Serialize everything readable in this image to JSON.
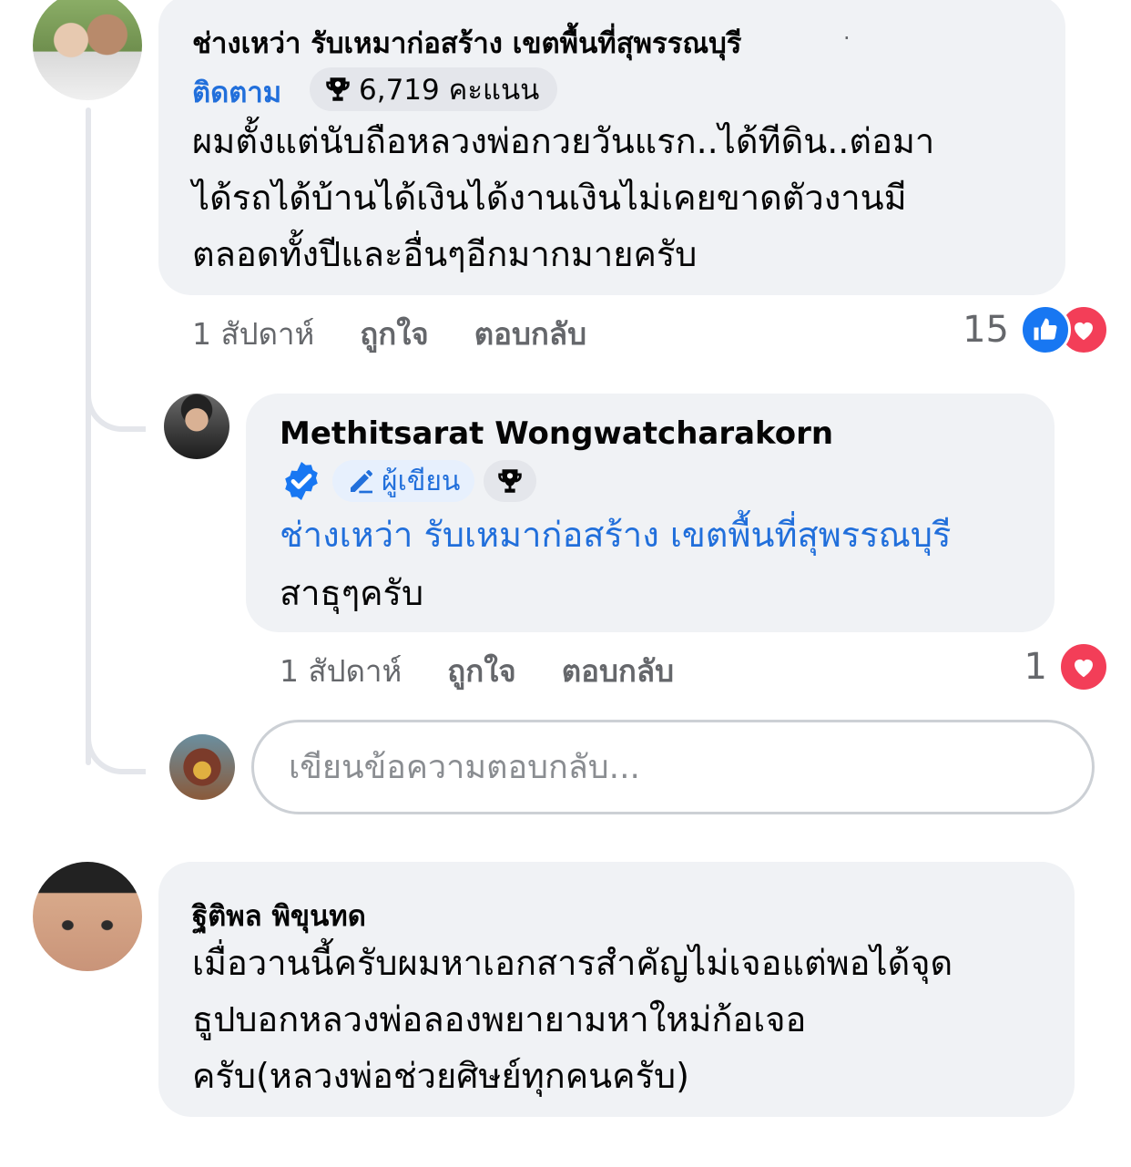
{
  "comment1": {
    "author": "ช่างเหว่า รับเหมาก่อสร้าง เขตพื้นที่สุพรรณบุรี",
    "separator": "·",
    "follow_label": "ติดตาม",
    "points_label": "6,719 คะแนน",
    "text_lines": [
      "ผมตั้งแต่นับถือหลวงพ่อกวยวันแรก..ได้ทีดิน..ต่อมา",
      "ได้รถได้บ้านได้เงินได้งานเงินไม่เคยขาดตัวงานมี",
      "ตลอดทั้งปีและอื่นๆอีกมากมายครับ"
    ],
    "time": "1 สัปดาห์",
    "like_label": "ถูกใจ",
    "reply_label": "ตอบกลับ",
    "reaction_count": "15",
    "reactions": [
      "like-icon",
      "love-icon"
    ]
  },
  "reply1": {
    "author": "Methitsarat Wongwatcharakorn",
    "verified": true,
    "author_badge_label": "ผู้เขียน",
    "mention": "ช่างเหว่า รับเหมาก่อสร้าง เขตพื้นที่สุพรรณบุรี",
    "text": "สาธุๆครับ",
    "time": "1 สัปดาห์",
    "like_label": "ถูกใจ",
    "reply_label": "ตอบกลับ",
    "reaction_count": "1",
    "reactions": [
      "love-icon"
    ]
  },
  "reply_input": {
    "placeholder": "เขียนข้อความตอบกลับ..."
  },
  "comment2": {
    "author": "ฐิติพล พิขุนทด",
    "text_lines": [
      "เมื่อวานนี้ครับผมหาเอกสารสำคัญไม่เจอแต่พอได้จุด",
      "ธูปบอกหลวงพ่อลองพยายามหาใหม่ก้อเจอ",
      "ครับ(หลวงพ่อช่วยศิษย์ทุกคนครับ)"
    ]
  },
  "colors": {
    "link_blue": "#216fdb",
    "bubble_bg": "#f0f2f5",
    "meta_gray": "#65676b",
    "like_blue": "#1877f2",
    "love_red": "#f33e58"
  }
}
